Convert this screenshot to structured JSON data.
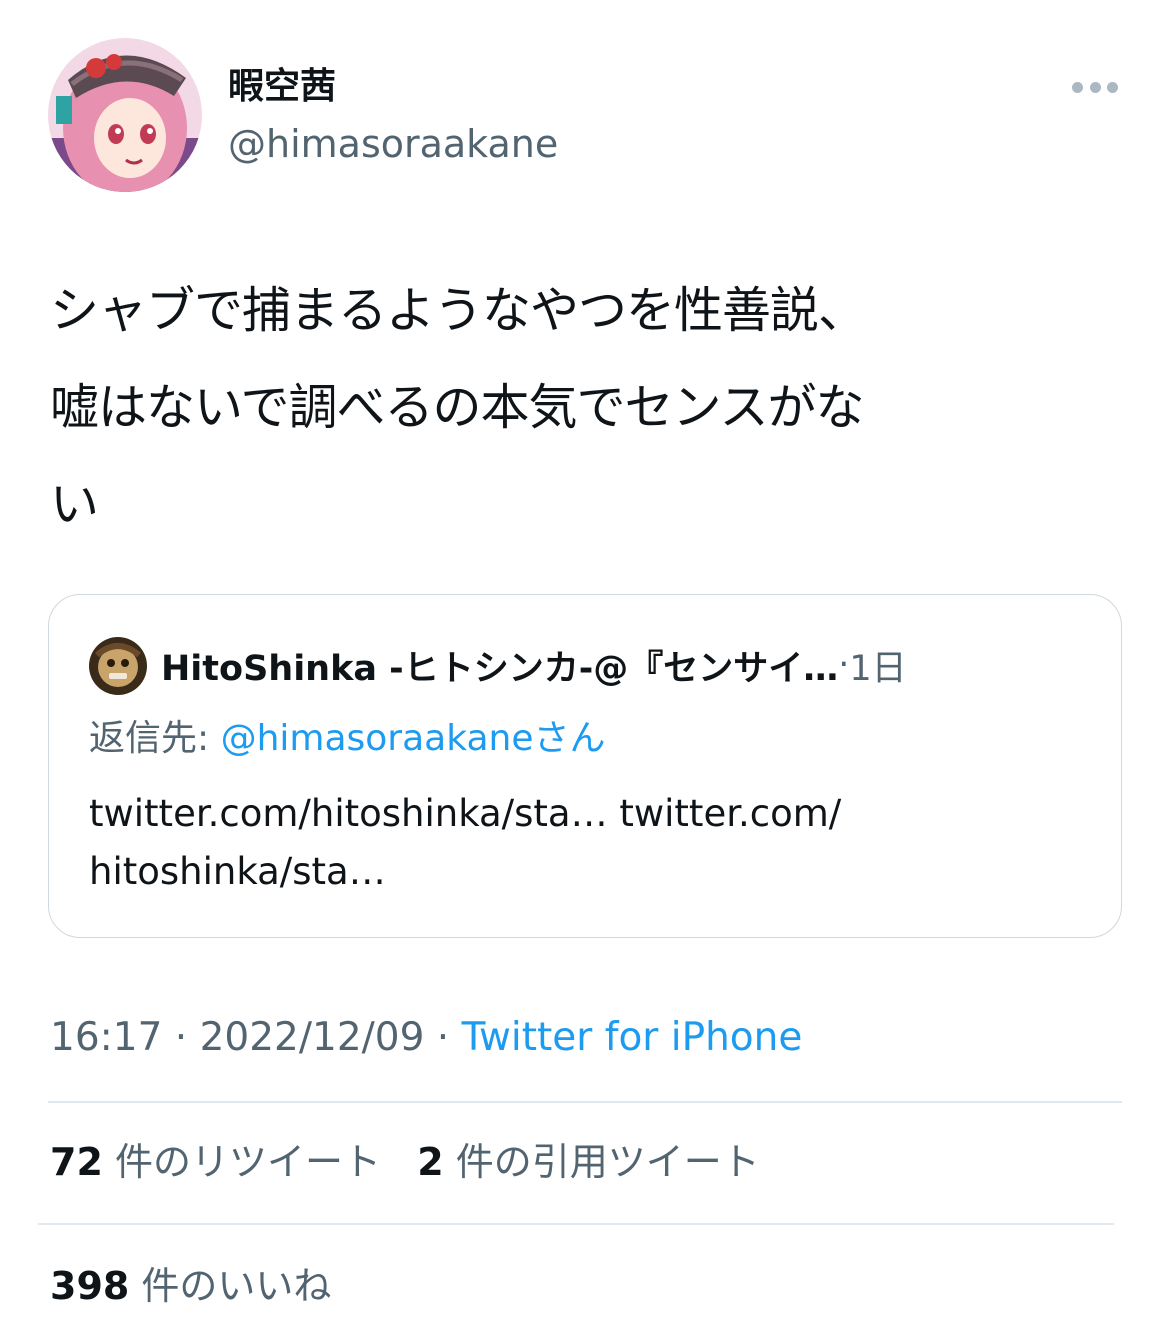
{
  "author": {
    "name": "暇空茜",
    "handle": "@himasoraakane",
    "avatar": "anime-girl-avatar"
  },
  "tweet": {
    "text": "シャブで捕まるようなやつを性善説、\n嘘はないで調べるの本気でセンスがな\nい"
  },
  "quote": {
    "author_name": "HitoShinka -ヒトシンカ-@『センサイ…",
    "time": "1日",
    "reply_label": "返信先: ",
    "reply_mention": "@himasoraakane",
    "reply_suffix": "さん",
    "link1": "twitter.com/hitoshinka/sta…",
    "link2": "twitter.com/",
    "link2b": "hitoshinka/sta…"
  },
  "meta": {
    "time": "16:17",
    "date": "2022/12/09",
    "source": "Twitter for iPhone",
    "separator": " · "
  },
  "stats": {
    "retweets_count": "72",
    "retweets_label": "件のリツイート",
    "quotes_count": "2",
    "quotes_label": "件の引用ツイート",
    "likes_count": "398",
    "likes_label": "件のいいね"
  },
  "colors": {
    "link": "#1d9bf0",
    "secondary": "#536471",
    "primary": "#0f1419",
    "border": "#cfd9de"
  }
}
